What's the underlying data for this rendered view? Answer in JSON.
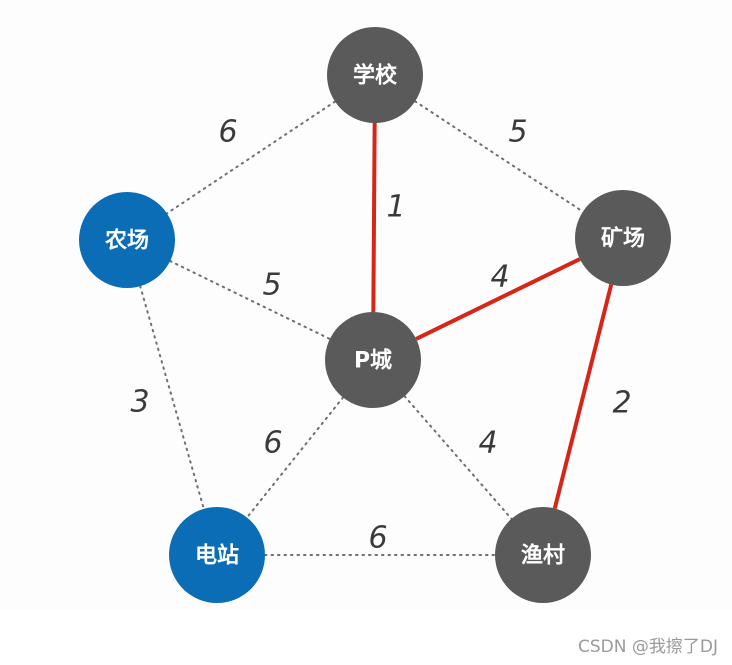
{
  "colors": {
    "node_gray": "#5a5a5a",
    "node_blue": "#0a6db5",
    "highlight_edge": "#d62618",
    "dotted_edge": "#6e6e6e"
  },
  "nodes": [
    {
      "id": "school",
      "label": "学校",
      "color": "#5a5a5a"
    },
    {
      "id": "farm",
      "label": "农场",
      "color": "#0a6db5"
    },
    {
      "id": "mine",
      "label": "矿场",
      "color": "#5a5a5a"
    },
    {
      "id": "pcity",
      "label": "P城",
      "color": "#5a5a5a"
    },
    {
      "id": "power",
      "label": "电站",
      "color": "#0a6db5"
    },
    {
      "id": "fishing",
      "label": "渔村",
      "color": "#5a5a5a"
    }
  ],
  "edges": [
    {
      "from": "school",
      "to": "farm",
      "weight": "6",
      "highlighted": false
    },
    {
      "from": "school",
      "to": "mine",
      "weight": "5",
      "highlighted": false
    },
    {
      "from": "school",
      "to": "pcity",
      "weight": "1",
      "highlighted": true
    },
    {
      "from": "farm",
      "to": "pcity",
      "weight": "5",
      "highlighted": false
    },
    {
      "from": "pcity",
      "to": "mine",
      "weight": "4",
      "highlighted": true
    },
    {
      "from": "mine",
      "to": "fishing",
      "weight": "2",
      "highlighted": true
    },
    {
      "from": "farm",
      "to": "power",
      "weight": "3",
      "highlighted": false
    },
    {
      "from": "pcity",
      "to": "power",
      "weight": "6",
      "highlighted": false
    },
    {
      "from": "pcity",
      "to": "fishing",
      "weight": "4",
      "highlighted": false
    },
    {
      "from": "power",
      "to": "fishing",
      "weight": "6",
      "highlighted": false
    }
  ],
  "watermark": "CSDN @我擦了DJ"
}
